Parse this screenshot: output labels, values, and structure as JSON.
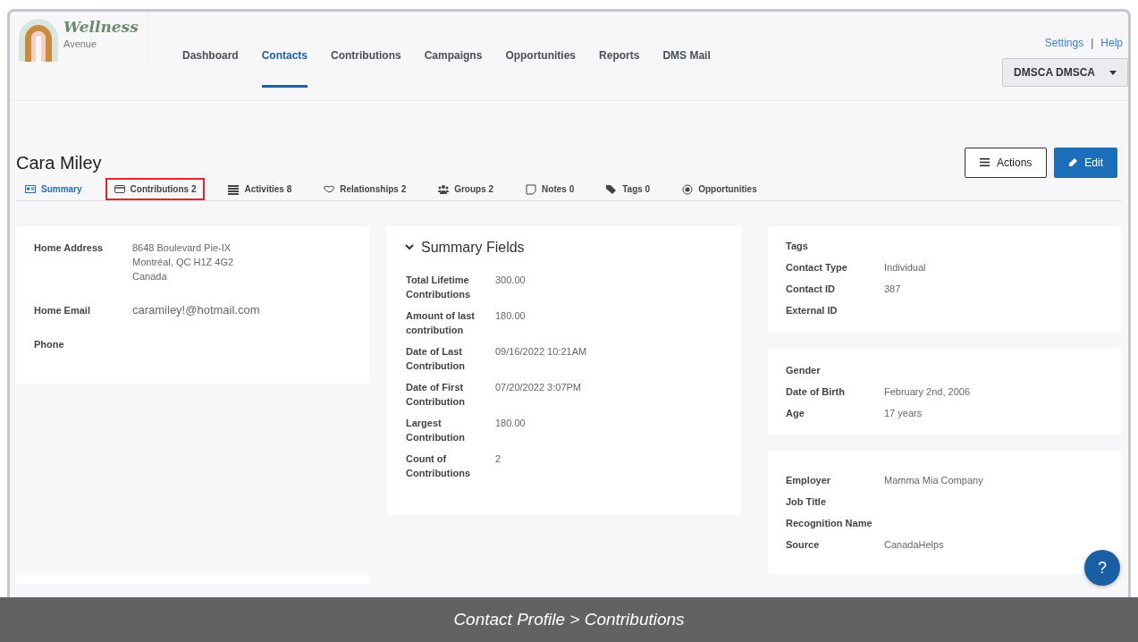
{
  "logo": {
    "script": "Wellness",
    "sub": "Avenue"
  },
  "nav": [
    {
      "label": "Dashboard",
      "selected": false
    },
    {
      "label": "Contacts",
      "selected": true
    },
    {
      "label": "Contributions",
      "selected": false
    },
    {
      "label": "Campaigns",
      "selected": false
    },
    {
      "label": "Opportunities",
      "selected": false
    },
    {
      "label": "Reports",
      "selected": false
    },
    {
      "label": "DMS Mail",
      "selected": false
    }
  ],
  "top_links": [
    "Settings",
    "Help"
  ],
  "top_separator": "|",
  "user_menu": "DMSCA DMSCA",
  "contact_name": "Cara Miley",
  "actions_button": "Actions",
  "edit_button": "Edit",
  "tabs": [
    {
      "label": "Summary",
      "selected": true,
      "highlighted": false
    },
    {
      "label": "Contributions 2",
      "selected": false,
      "highlighted": true
    },
    {
      "label": "Activities 8",
      "selected": false,
      "highlighted": false
    },
    {
      "label": "Relationships 2",
      "selected": false,
      "highlighted": false
    },
    {
      "label": "Groups 2",
      "selected": false,
      "highlighted": false
    },
    {
      "label": "Notes 0",
      "selected": false,
      "highlighted": false
    },
    {
      "label": "Tags 0",
      "selected": false,
      "highlighted": false
    },
    {
      "label": "Opportunities",
      "selected": false,
      "highlighted": false
    }
  ],
  "contact_card": {
    "fields": [
      {
        "label": "Home Address",
        "value_lines": [
          "8648 Boulevard Pie-IX",
          "Montréal, QC H1Z 4G2",
          "Canada"
        ]
      },
      {
        "label": "Home Email",
        "value_lines": [
          "caramiley!@hotmail.com"
        ]
      },
      {
        "label": "Phone"
      }
    ]
  },
  "summary_card": {
    "title": "Summary Fields",
    "expanded": true,
    "fields": [
      {
        "label": "Total Lifetime Contributions",
        "value": "300.00"
      },
      {
        "label": "Amount of last contribution",
        "value": "180.00"
      },
      {
        "label": "Date of Last Contribution",
        "value": "09/16/2022 10:21AM"
      },
      {
        "label": "Date of First Contribution",
        "value": "07/20/2022 3:07PM"
      },
      {
        "label": "Largest Contribution",
        "value": "180.00"
      },
      {
        "label": "Count of Contributions",
        "value": "2"
      }
    ]
  },
  "info_cards": [
    {
      "fields": [
        {
          "label": "Tags"
        },
        {
          "label": "Contact Type",
          "value": "Individual"
        },
        {
          "label": "Contact ID",
          "value": "387"
        },
        {
          "label": "External ID"
        }
      ]
    },
    {
      "fields": [
        {
          "label": "Gender"
        },
        {
          "label": "Date of Birth",
          "value": "February 2nd, 2006"
        },
        {
          "label": "Age",
          "value": "17 years"
        }
      ]
    },
    {
      "fields": [
        {
          "label": "Employer",
          "value": "Mamma Mia Company"
        },
        {
          "label": "Job Title"
        },
        {
          "label": "Recognition Name"
        },
        {
          "label": "Source",
          "value": "CanadaHelps"
        }
      ]
    }
  ],
  "help_button": "?",
  "caption": "Contact Profile > Contributions"
}
